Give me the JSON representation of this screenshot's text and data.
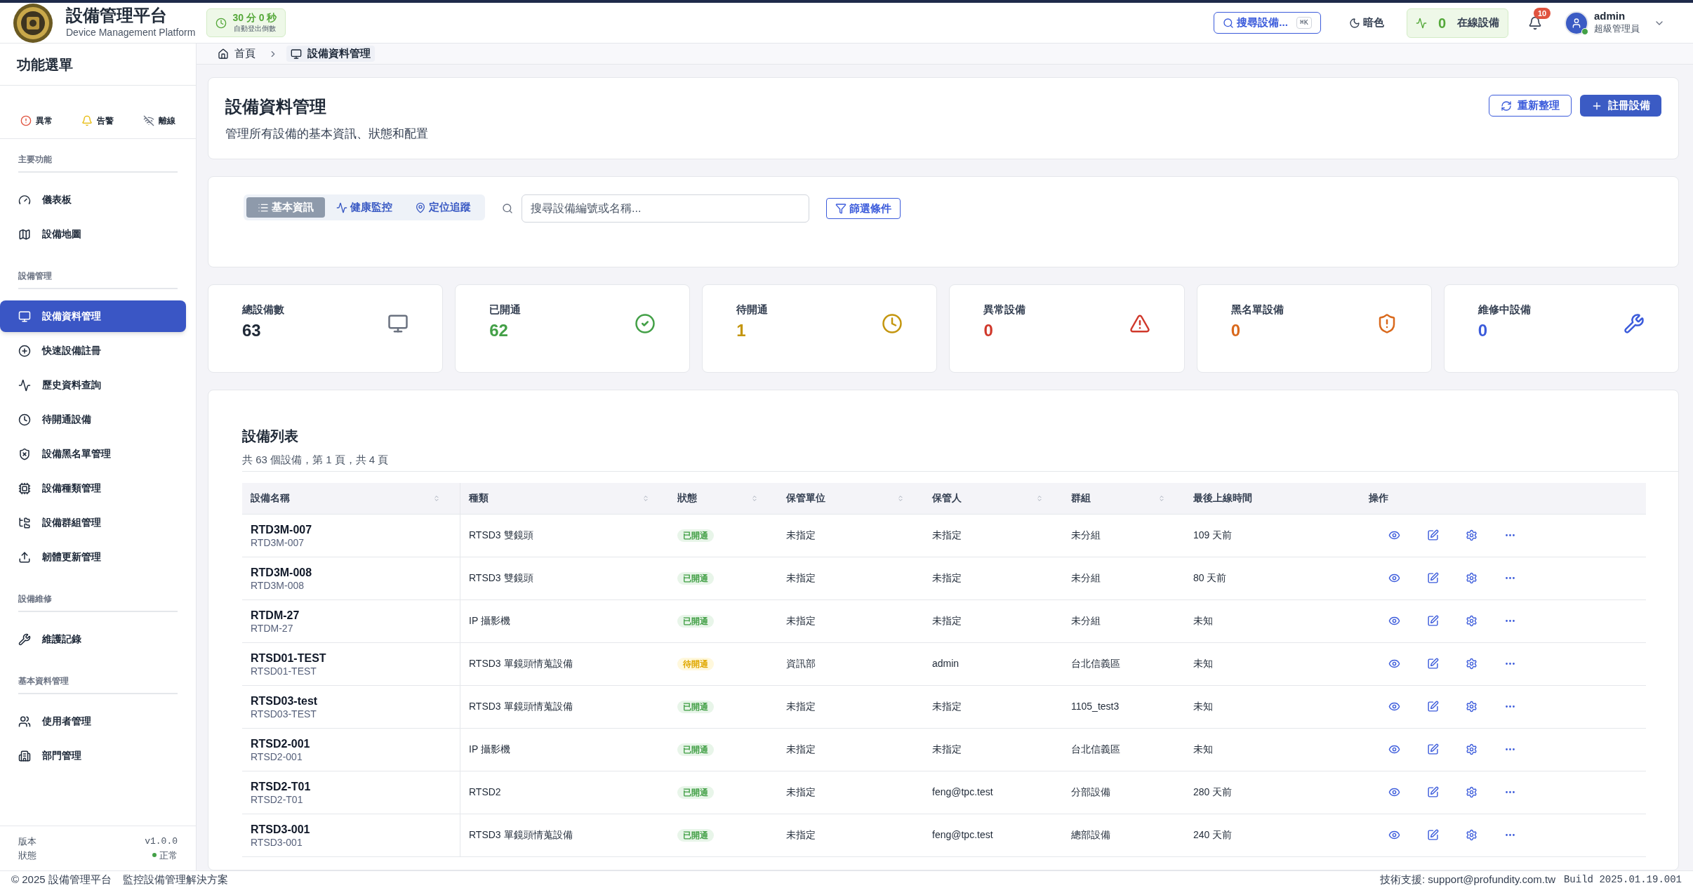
{
  "header": {
    "title": "設備管理平台",
    "subtitle": "Device Management Platform",
    "timer": {
      "value": "30 分 0 秒",
      "label": "自動登出倒數"
    },
    "search": {
      "label": "搜尋設備...",
      "shortcut": "⌘K"
    },
    "theme_toggle": "暗色",
    "online": {
      "count": "0",
      "label": "在線設備"
    },
    "notifications": {
      "count": "10"
    },
    "user": {
      "name": "admin",
      "role": "超級管理員",
      "online": true
    }
  },
  "sidebar": {
    "title": "功能選單",
    "alerts": [
      {
        "label": "異常",
        "kind": "error"
      },
      {
        "label": "告警",
        "kind": "warning"
      },
      {
        "label": "離線",
        "kind": "offline"
      }
    ],
    "sections": [
      {
        "title": "主要功能",
        "items": [
          {
            "label": "儀表板",
            "selected": false
          },
          {
            "label": "設備地圖",
            "selected": false
          }
        ]
      },
      {
        "title": "設備管理",
        "items": [
          {
            "label": "設備資料管理",
            "selected": true
          },
          {
            "label": "快速設備註冊",
            "selected": false
          },
          {
            "label": "歷史資料查詢",
            "selected": false
          },
          {
            "label": "待開通設備",
            "selected": false
          },
          {
            "label": "設備黑名單管理",
            "selected": false
          },
          {
            "label": "設備種類管理",
            "selected": false
          },
          {
            "label": "設備群組管理",
            "selected": false
          },
          {
            "label": "韌體更新管理",
            "selected": false
          }
        ]
      },
      {
        "title": "設備維修",
        "items": [
          {
            "label": "維護記錄",
            "selected": false
          }
        ]
      },
      {
        "title": "基本資料管理",
        "items": [
          {
            "label": "使用者管理",
            "selected": false
          },
          {
            "label": "部門管理",
            "selected": false
          }
        ]
      }
    ],
    "version_label": "版本",
    "version": "v1.0.0",
    "status_label": "狀態",
    "status": "正常"
  },
  "breadcrumb": [
    {
      "label": "首頁",
      "current": false
    },
    {
      "label": "設備資料管理",
      "current": true
    }
  ],
  "page": {
    "title": "設備資料管理",
    "description": "管理所有設備的基本資訊、狀態和配置",
    "buttons": [
      {
        "label": "重新整理",
        "kind": "outline"
      },
      {
        "label": "註冊設備",
        "kind": "primary"
      }
    ]
  },
  "toolbar": {
    "tabs": [
      {
        "label": "基本資訊",
        "selected": true
      },
      {
        "label": "健康監控",
        "selected": false
      },
      {
        "label": "定位追蹤",
        "selected": false
      }
    ],
    "search": {
      "placeholder": "搜尋設備編號或名稱..."
    },
    "filter": "篩選條件"
  },
  "stats": [
    {
      "label": "總設備數",
      "value": "63",
      "color": "#1f2937"
    },
    {
      "label": "已開通",
      "value": "62",
      "color": "#43a047"
    },
    {
      "label": "待開通",
      "value": "1",
      "color": "#c4960f"
    },
    {
      "label": "異常設備",
      "value": "0",
      "color": "#d0382b"
    },
    {
      "label": "黑名單設備",
      "value": "0",
      "color": "#d9691c"
    },
    {
      "label": "維修中設備",
      "value": "0",
      "color": "#3b5bdb"
    }
  ],
  "table": {
    "title": "設備列表",
    "summary": "共 63 個設備，第 1 頁，共 4 頁",
    "columns": [
      {
        "label": "設備名稱",
        "sortable": true
      },
      {
        "label": "種類",
        "sortable": true
      },
      {
        "label": "狀態",
        "sortable": true
      },
      {
        "label": "保管單位",
        "sortable": true
      },
      {
        "label": "保管人",
        "sortable": true
      },
      {
        "label": "群組",
        "sortable": true
      },
      {
        "label": "最後上線時間",
        "sortable": false
      },
      {
        "label": "操作",
        "sortable": false
      }
    ],
    "rows": [
      {
        "name": "RTD3M-007",
        "code": "RTD3M-007",
        "type": "RTSD3 雙鏡頭",
        "status": {
          "label": "已開通",
          "kind": "active"
        },
        "unit": "未指定",
        "custodian": "未指定",
        "group": "未分組",
        "last_online": "109 天前"
      },
      {
        "name": "RTD3M-008",
        "code": "RTD3M-008",
        "type": "RTSD3 雙鏡頭",
        "status": {
          "label": "已開通",
          "kind": "active"
        },
        "unit": "未指定",
        "custodian": "未指定",
        "group": "未分組",
        "last_online": "80 天前"
      },
      {
        "name": "RTDM-27",
        "code": "RTDM-27",
        "type": "IP 攝影機",
        "status": {
          "label": "已開通",
          "kind": "active"
        },
        "unit": "未指定",
        "custodian": "未指定",
        "group": "未分組",
        "last_online": "未知"
      },
      {
        "name": "RTSD01-TEST",
        "code": "RTSD01-TEST",
        "type": "RTSD3 單鏡頭情蒐設備",
        "status": {
          "label": "待開通",
          "kind": "pending"
        },
        "unit": "資訊部",
        "custodian": "admin",
        "group": "台北信義區",
        "last_online": "未知"
      },
      {
        "name": "RTSD03-test",
        "code": "RTSD03-TEST",
        "type": "RTSD3 單鏡頭情蒐設備",
        "status": {
          "label": "已開通",
          "kind": "active"
        },
        "unit": "未指定",
        "custodian": "未指定",
        "group": "1105_test3",
        "last_online": "未知"
      },
      {
        "name": "RTSD2-001",
        "code": "RTSD2-001",
        "type": "IP 攝影機",
        "status": {
          "label": "已開通",
          "kind": "active"
        },
        "unit": "未指定",
        "custodian": "未指定",
        "group": "台北信義區",
        "last_online": "未知"
      },
      {
        "name": "RTSD2-T01",
        "code": "RTSD2-T01",
        "type": "RTSD2",
        "status": {
          "label": "已開通",
          "kind": "active"
        },
        "unit": "未指定",
        "custodian": "feng@tpc.test",
        "group": "分部設備",
        "last_online": "280 天前"
      },
      {
        "name": "RTSD3-001",
        "code": "RTSD3-001",
        "type": "RTSD3 單鏡頭情蒐設備",
        "status": {
          "label": "已開通",
          "kind": "active"
        },
        "unit": "未指定",
        "custodian": "feng@tpc.test",
        "group": "總部設備",
        "last_online": "240 天前"
      }
    ]
  },
  "footer": {
    "copyright": "© 2025 設備管理平台",
    "tagline": "監控設備管理解決方案",
    "support": "技術支援: support@profundity.com.tw",
    "build": "Build 2025.01.19.001"
  }
}
